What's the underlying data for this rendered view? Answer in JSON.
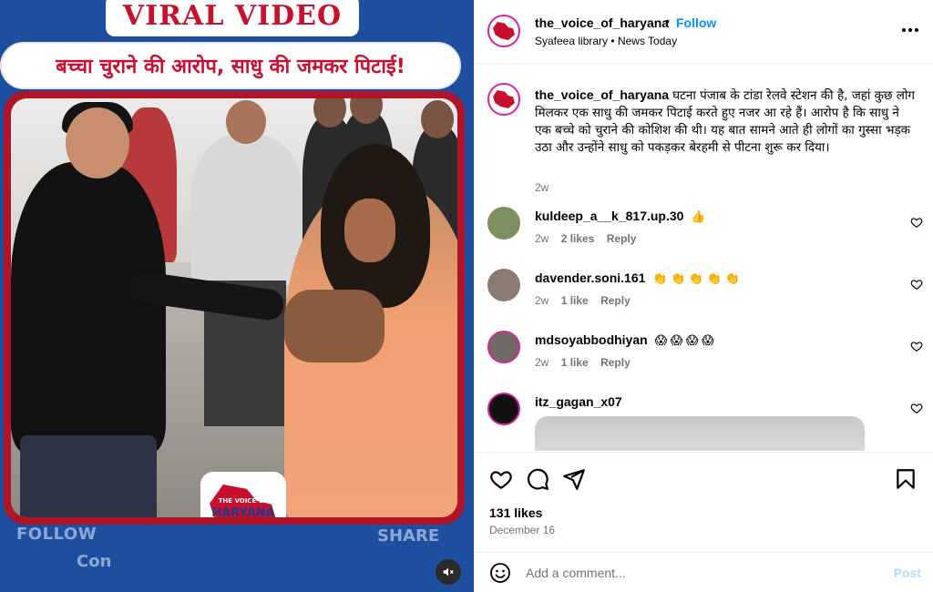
{
  "media": {
    "viral_label": "VIRAL VIDEO",
    "headline": "बच्चा चुराने की आरोप, साधु की जमकर पिटाई!",
    "logo_small": "THE VOICE OF",
    "logo_text": "HARYANA",
    "follow_text": "FOLLOW",
    "share_text": "SHARE",
    "con_text": "Con",
    "mute_icon": "speaker-muted-icon",
    "colors": {
      "background": "#1d4f9e",
      "frame": "#b01428",
      "accent": "#c8102e"
    }
  },
  "header": {
    "username": "the_voice_of_haryana",
    "separator": "•",
    "follow_label": "Follow",
    "audio": "Syafeea library",
    "audio_sep": "•",
    "tag": "News Today",
    "more_icon": "more-options-icon"
  },
  "caption": {
    "username": "the_voice_of_haryana",
    "text": "घटना पंजाब के टांडा रेलवे स्टेशन की है, जहां कुछ लोग मिलकर एक साधु की जमकर पिटाई करते हुए नजर आ रहे हैं। आरोप है कि साधु ने एक बच्चे को चुराने की कोशिश की थी। यह बात सामने आते ही लोगों का गुस्सा भड़क उठा और उन्होंने साधु को पकड़कर बेरहमी से पीटना शुरू कर दिया।",
    "time": "2w"
  },
  "comments": [
    {
      "username": "kuldeep_a__k_817.up.30",
      "text": "👍",
      "time": "2w",
      "likes": "2 likes",
      "reply": "Reply"
    },
    {
      "username": "davender.soni.161",
      "text": "👏 👏 👏 👏 👏",
      "time": "2w",
      "likes": "1 like",
      "reply": "Reply"
    },
    {
      "username": "mdsoyabbodhiyan",
      "text": "😱 😱 😱 😱",
      "time": "2w",
      "likes": "1 like",
      "reply": "Reply"
    },
    {
      "username": "itz_gagan_x07",
      "text": "",
      "time": "",
      "likes": "",
      "reply": ""
    }
  ],
  "actions": {
    "likes": "131 likes",
    "date": "December 16",
    "icons": [
      "heart-icon",
      "comment-icon",
      "share-icon",
      "bookmark-icon"
    ]
  },
  "add_comment": {
    "placeholder": "Add a comment...",
    "post_label": "Post",
    "emoji_icon": "emoji-icon"
  }
}
